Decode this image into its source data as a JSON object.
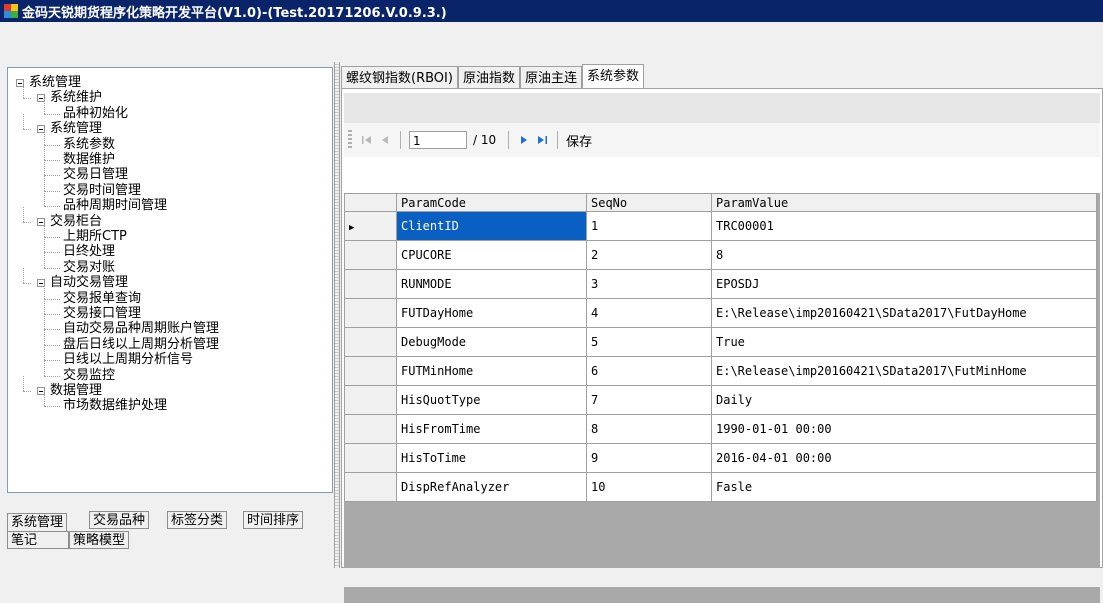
{
  "window": {
    "title": "金码天锐期货程序化策略开发平台(V1.0)-(Test.20171206.V.0.9.3.)"
  },
  "tree": {
    "nodes": [
      {
        "label": "系统管理",
        "level": 0,
        "expandable": true
      },
      {
        "label": "系统维护",
        "level": 1,
        "expandable": true
      },
      {
        "label": "品种初始化",
        "level": 2,
        "expandable": false
      },
      {
        "label": "系统管理",
        "level": 1,
        "expandable": true
      },
      {
        "label": "系统参数",
        "level": 2,
        "expandable": false
      },
      {
        "label": "数据维护",
        "level": 2,
        "expandable": false
      },
      {
        "label": "交易日管理",
        "level": 2,
        "expandable": false
      },
      {
        "label": "交易时间管理",
        "level": 2,
        "expandable": false
      },
      {
        "label": "品种周期时间管理",
        "level": 2,
        "expandable": false
      },
      {
        "label": "交易柜台",
        "level": 1,
        "expandable": true
      },
      {
        "label": "上期所CTP",
        "level": 2,
        "expandable": false
      },
      {
        "label": "日终处理",
        "level": 2,
        "expandable": false
      },
      {
        "label": "交易对账",
        "level": 2,
        "expandable": false
      },
      {
        "label": "自动交易管理",
        "level": 1,
        "expandable": true
      },
      {
        "label": "交易报单查询",
        "level": 2,
        "expandable": false
      },
      {
        "label": "交易接口管理",
        "level": 2,
        "expandable": false
      },
      {
        "label": "自动交易品种周期账户管理",
        "level": 2,
        "expandable": false
      },
      {
        "label": "盘后日线以上周期分析管理",
        "level": 2,
        "expandable": false
      },
      {
        "label": "日线以上周期分析信号",
        "level": 2,
        "expandable": false
      },
      {
        "label": "交易监控",
        "level": 2,
        "expandable": false
      },
      {
        "label": "数据管理",
        "level": 1,
        "expandable": true
      },
      {
        "label": "市场数据维护处理",
        "level": 2,
        "expandable": false
      }
    ]
  },
  "left_tabs": {
    "row1": [
      "系统管理",
      "交易品种",
      "标签分类",
      "时间排序"
    ],
    "row2": [
      "笔记",
      "策略模型"
    ]
  },
  "right_tabs": [
    "螺纹钢指数(RBOI)",
    "原油指数",
    "原油主连",
    "系统参数"
  ],
  "toolbar": {
    "current_page": "1",
    "page_of": "/ 10",
    "save_label": "保存"
  },
  "grid": {
    "columns": [
      "ParamCode",
      "SeqNo",
      "ParamValue"
    ],
    "rows": [
      [
        "ClientID",
        "1",
        "TRC00001"
      ],
      [
        "CPUCORE",
        "2",
        "8"
      ],
      [
        "RUNMODE",
        "3",
        "EPOSDJ"
      ],
      [
        "FUTDayHome",
        "4",
        "E:\\Release\\imp20160421\\SData2017\\FutDayHome"
      ],
      [
        "DebugMode",
        "5",
        "True"
      ],
      [
        "FUTMinHome",
        "6",
        "E:\\Release\\imp20160421\\SData2017\\FutMinHome"
      ],
      [
        "HisQuotType",
        "7",
        "Daily"
      ],
      [
        "HisFromTime",
        "8",
        "1990-01-01 00:00"
      ],
      [
        "HisToTime",
        "9",
        "2016-04-01 00:00"
      ],
      [
        "DispRefAnalyzer",
        "10",
        "Fasle"
      ]
    ]
  },
  "colors": {
    "titlebar": "#0a246a",
    "selection": "#0a5fc2",
    "grid_background": "#a9a9a9"
  }
}
